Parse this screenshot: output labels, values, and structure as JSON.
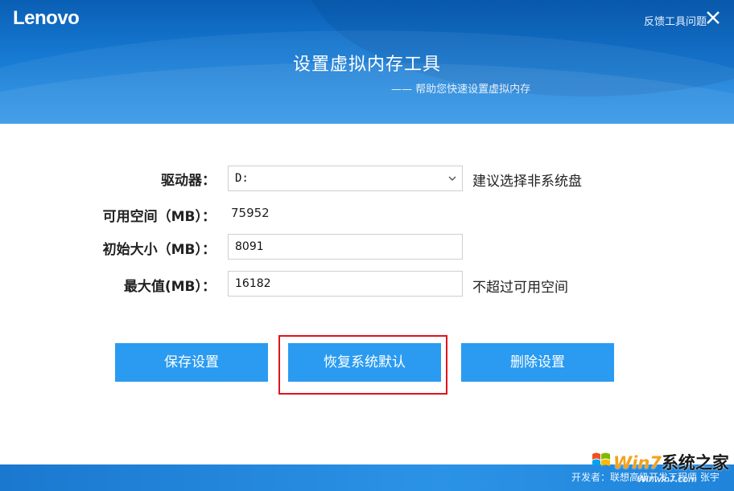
{
  "header": {
    "logo": "Lenovo",
    "feedback_label": "反馈工具问题",
    "title": "设置虚拟内存工具",
    "subtitle": "—— 帮助您快速设置虚拟内存"
  },
  "form": {
    "drive_label": "驱动器：",
    "drive_value": "D:",
    "drive_hint": "建议选择非系统盘",
    "free_space_label": "可用空间（MB）：",
    "free_space_value": "75952",
    "initial_size_label": "初始大小（MB）：",
    "initial_size_value": "8091",
    "max_size_label": "最大值(MB）：",
    "max_size_value": "16182",
    "max_size_hint": "不超过可用空间"
  },
  "buttons": {
    "save": "保存设置",
    "restore": "恢复系统默认",
    "delete": "删除设置"
  },
  "footer": {
    "text": "开发者：联想高级开发工程师 张宇"
  },
  "watermark": {
    "brand_w7": "Win7",
    "brand_rest": "系统之家",
    "url": "Winwin7.com"
  },
  "colors": {
    "header_blue": "#1679d2",
    "button_blue": "#2a9bf0",
    "highlight_red": "#e0141c"
  }
}
